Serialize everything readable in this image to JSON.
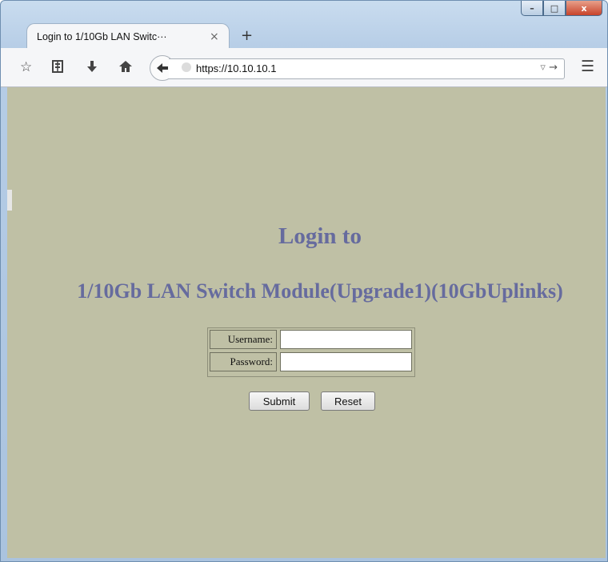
{
  "browser": {
    "tab_title": "Login to 1/10Gb LAN Switc···",
    "tab_close": "×",
    "new_tab": "+",
    "url": "https://10.10.10.1",
    "window_buttons": {
      "minimize": "–",
      "maximize": "□",
      "close": "x"
    },
    "toolbar_icons": [
      "star-icon",
      "reading-list-icon",
      "download-icon",
      "home-icon",
      "back-icon",
      "menu-icon"
    ]
  },
  "page": {
    "background_color": "#bfc0a5",
    "heading_color": "#666b9e",
    "title": "Login to",
    "subtitle": "1/10Gb LAN Switch Module(Upgrade1)(10GbUplinks)",
    "form": {
      "username_label": "Username:",
      "username_value": "",
      "password_label": "Password:",
      "password_value": ""
    },
    "buttons": {
      "submit": "Submit",
      "reset": "Reset"
    }
  }
}
